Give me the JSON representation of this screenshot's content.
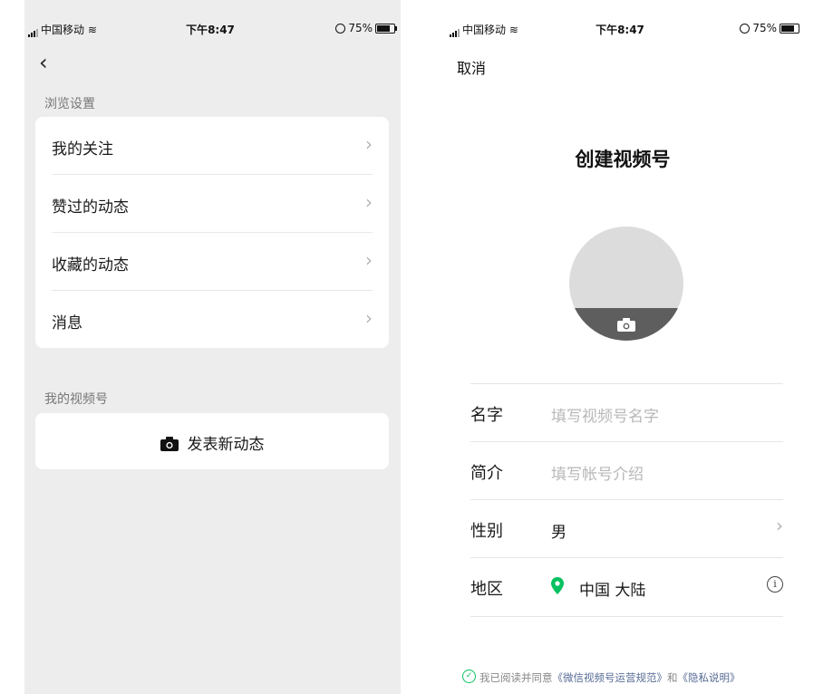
{
  "status_bar": {
    "carrier": "中国移动",
    "time": "下午8:47",
    "battery": "75%"
  },
  "left_screen": {
    "back_icon": "chevron-left-icon",
    "browse_section": {
      "title": "浏览设置",
      "items": [
        {
          "label": "我的关注"
        },
        {
          "label": "赞过的动态"
        },
        {
          "label": "收藏的动态"
        },
        {
          "label": "消息"
        }
      ]
    },
    "channel_section": {
      "title": "我的视频号",
      "post_button": {
        "label": "发表新动态",
        "icon": "camera-icon"
      }
    }
  },
  "right_screen": {
    "cancel_label": "取消",
    "title": "创建视频号",
    "avatar_icon": "camera-icon",
    "form": {
      "name": {
        "label": "名字",
        "placeholder": "填写视频号名字"
      },
      "intro": {
        "label": "简介",
        "placeholder": "填写帐号介绍"
      },
      "gender": {
        "label": "性别",
        "value": "男"
      },
      "region": {
        "label": "地区",
        "value": "中国 大陆",
        "icon": "location-pin-icon",
        "info_icon": "info-icon"
      }
    },
    "agreement": {
      "prefix": "我已阅读并同意",
      "link1": "《微信视频号运营规范》",
      "conj": "和",
      "link2": "《隐私说明》",
      "checked": true
    }
  },
  "colors": {
    "accent_green": "#07c160",
    "link_blue": "#576b95",
    "page_gray": "#ededed"
  }
}
